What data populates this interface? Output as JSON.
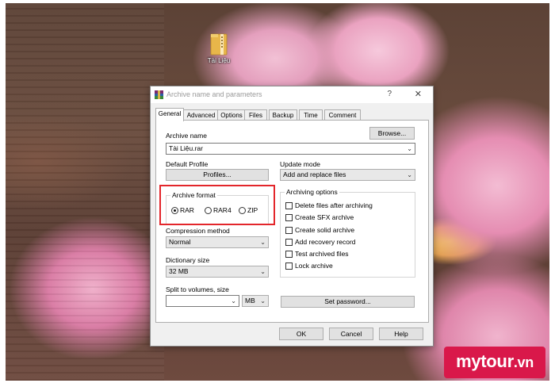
{
  "desktop": {
    "icon_label": "Tài Liệu"
  },
  "dialog": {
    "title": "Archive name and parameters",
    "help_glyph": "?",
    "close_glyph": "✕",
    "tabs": [
      "General",
      "Advanced",
      "Options",
      "Files",
      "Backup",
      "Time",
      "Comment"
    ],
    "active_tab": "General",
    "archive_name_label": "Archive name",
    "browse_label": "Browse...",
    "archive_name_value": "Tài Liệu.rar",
    "default_profile_label": "Default Profile",
    "profiles_label": "Profiles...",
    "update_mode_label": "Update mode",
    "update_mode_value": "Add and replace files",
    "archive_format": {
      "title": "Archive format",
      "options": [
        "RAR",
        "RAR4",
        "ZIP"
      ],
      "selected": "RAR"
    },
    "compression_method_label": "Compression method",
    "compression_method_value": "Normal",
    "dictionary_size_label": "Dictionary size",
    "dictionary_size_value": "32 MB",
    "split_label": "Split to volumes, size",
    "split_value": "",
    "split_unit": "MB",
    "archiving_options": {
      "title": "Archiving options",
      "items": [
        {
          "label": "Delete files after archiving",
          "checked": false
        },
        {
          "label": "Create SFX archive",
          "checked": false
        },
        {
          "label": "Create solid archive",
          "checked": false
        },
        {
          "label": "Add recovery record",
          "checked": false
        },
        {
          "label": "Test archived files",
          "checked": false
        },
        {
          "label": "Lock archive",
          "checked": false
        }
      ]
    },
    "set_password_label": "Set password...",
    "ok_label": "OK",
    "cancel_label": "Cancel",
    "help_label": "Help"
  },
  "watermark": {
    "text": "mytour",
    "suffix": ".vn"
  },
  "colors": {
    "highlight_box": "#e3262b",
    "watermark_bg": "#d9184a"
  }
}
